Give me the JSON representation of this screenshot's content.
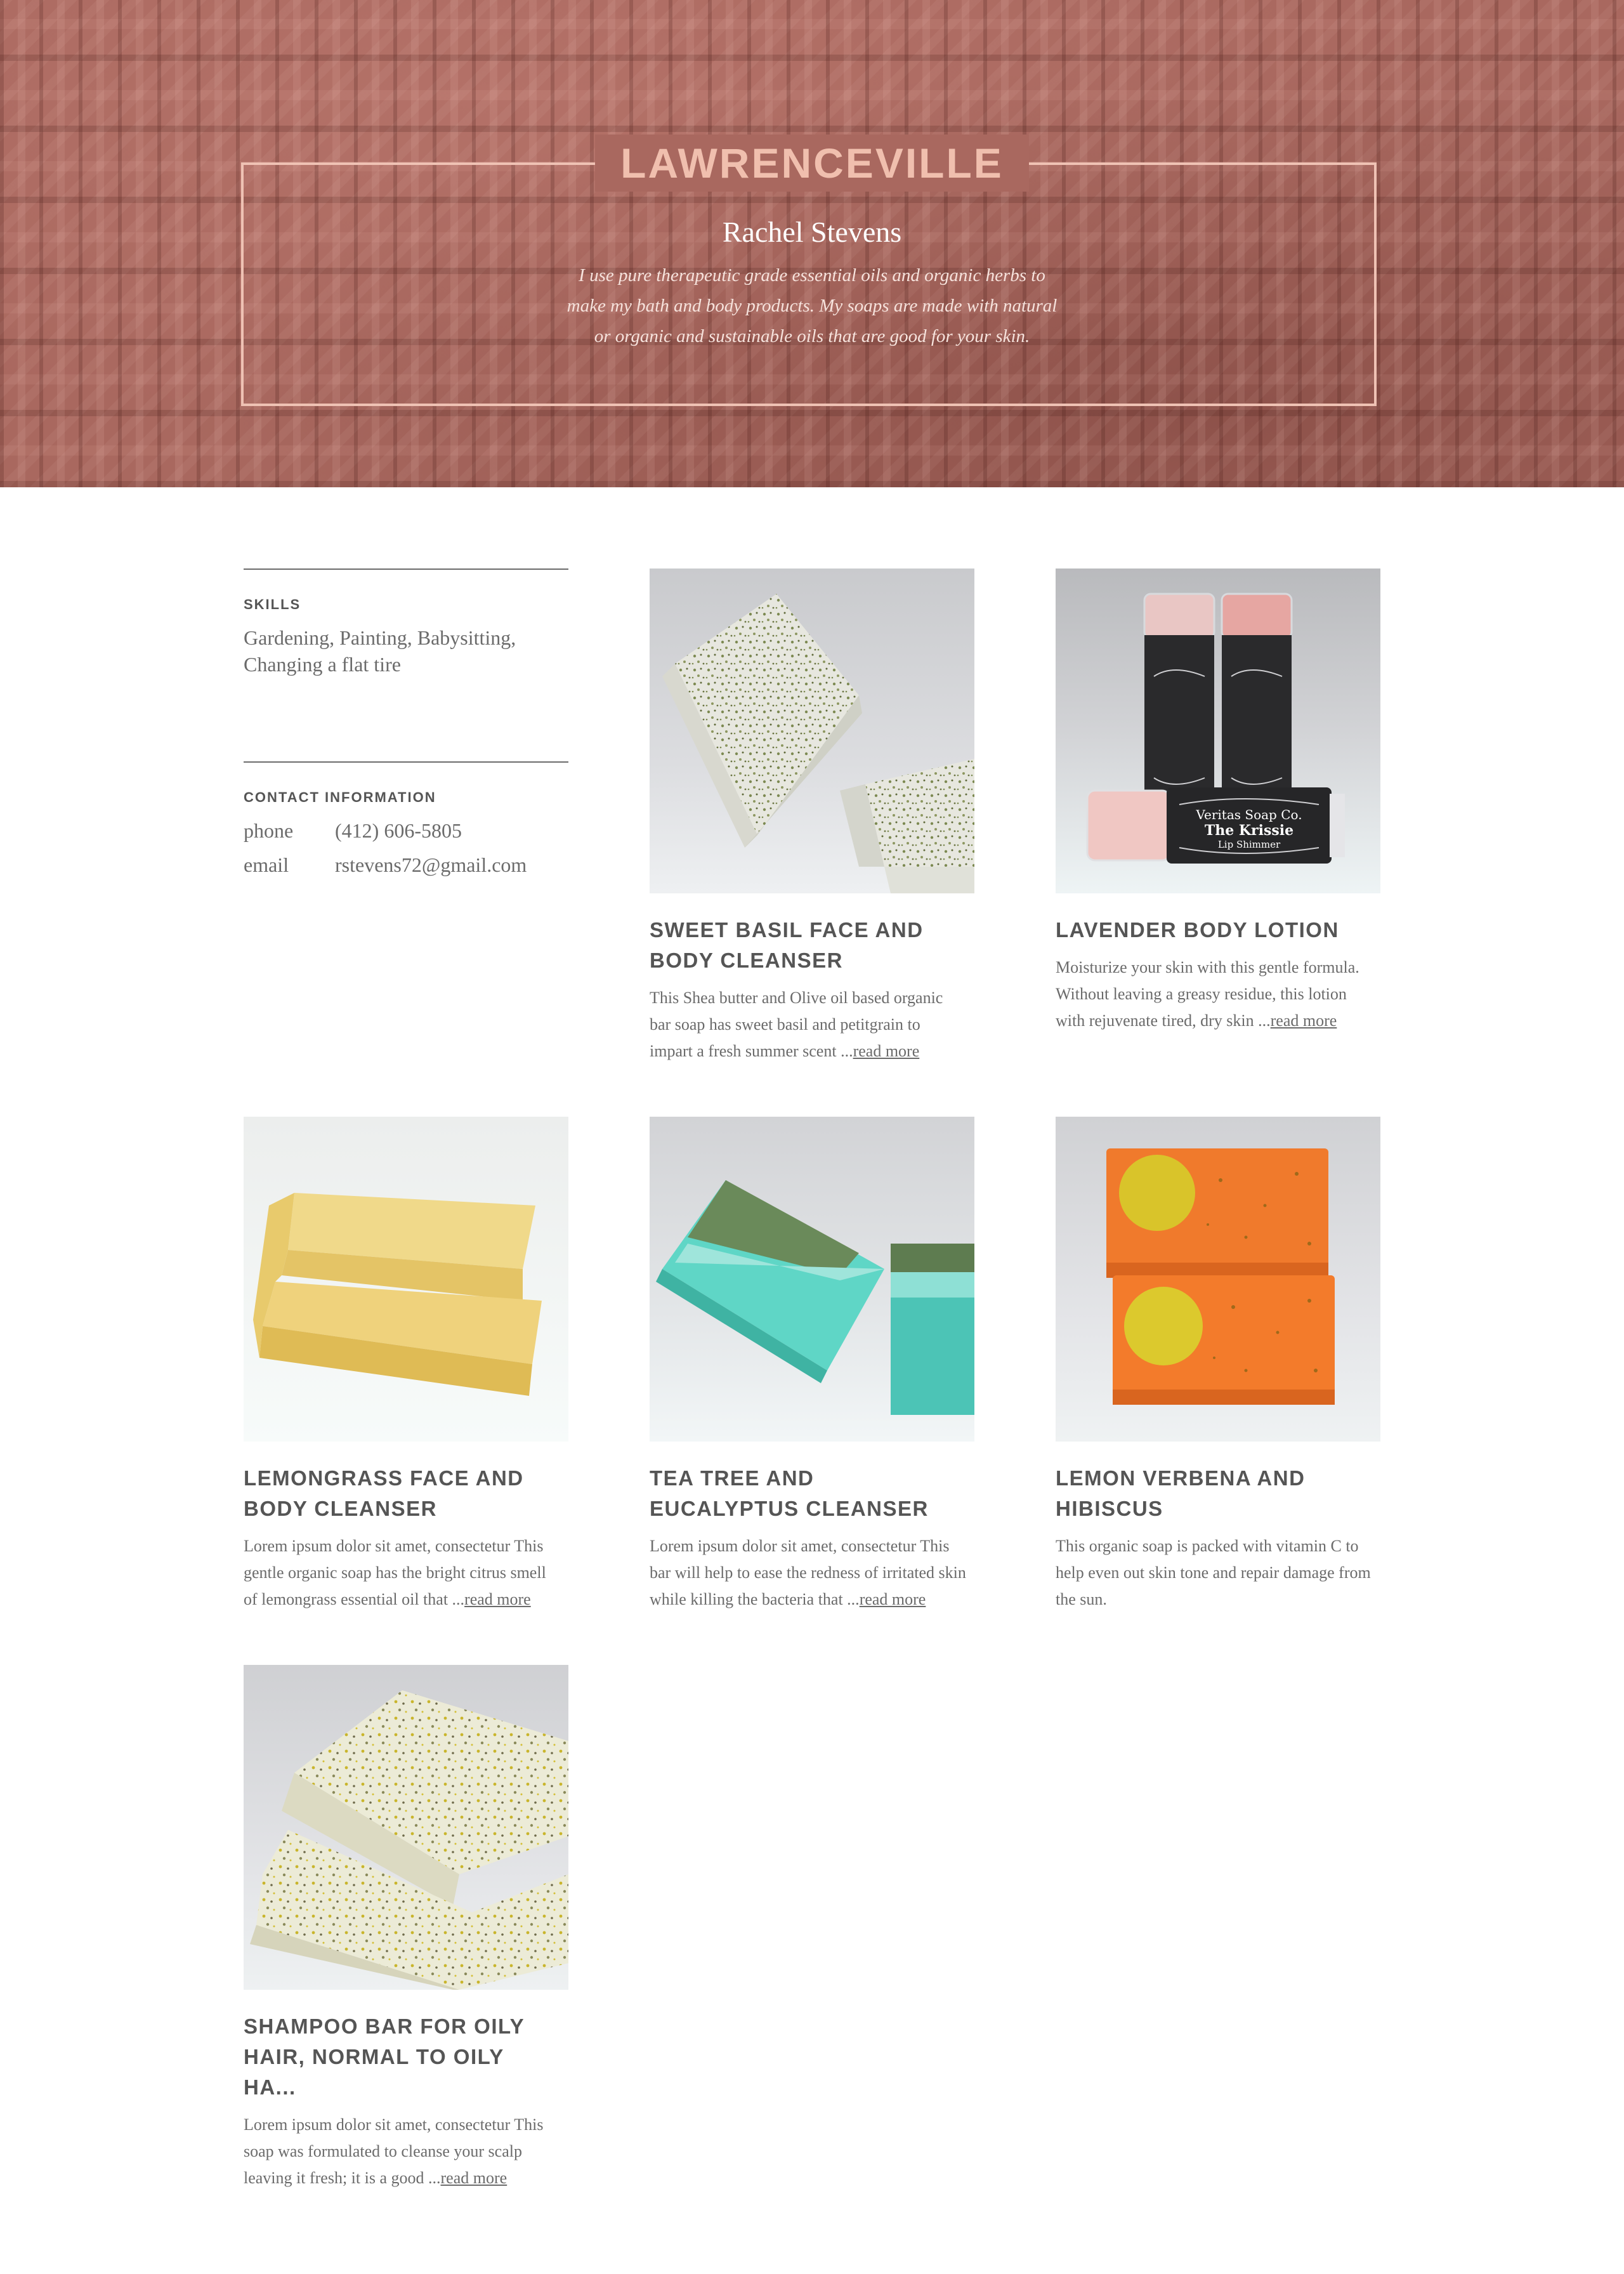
{
  "hero": {
    "title": "LAWRENCEVILLE",
    "name": "Rachel Stevens",
    "description": "I use pure therapeutic grade essential oils and organic herbs to make my bath and body products. My soaps are made with natural or organic and sustainable oils that are good for your skin."
  },
  "sidebar": {
    "skills": {
      "heading": "SKILLS",
      "text": "Gardening, Painting, Babysitting, Changing a flat tire"
    },
    "contact": {
      "heading": "CONTACT INFORMATION",
      "phone_label": "phone",
      "phone": "(412) 606-5805",
      "email_label": "email",
      "email": "rstevens72@gmail.com"
    }
  },
  "products": [
    {
      "title": "SWEET BASIL FACE AND BODY CLEANSER",
      "description": "This Shea butter and Olive oil based organic bar soap has sweet basil and petitgrain to impart a fresh summer scent ...",
      "more": "read more"
    },
    {
      "title": "LAVENDER BODY LOTION",
      "description": "Moisturize your skin with this gentle formula. Without leaving a greasy residue, this lotion with rejuvenate tired, dry skin ...",
      "more": "read more",
      "label_brand": "Veritas Soap Co.",
      "label_name": "The Krissie",
      "label_sub": "Lip Shimmer"
    },
    {
      "title": "LEMONGRASS FACE AND BODY CLEANSER",
      "description": "Lorem ipsum dolor sit amet, consectetur This gentle organic soap has the bright citrus smell of lemongrass essential oil that  ...",
      "more": "read more"
    },
    {
      "title": "TEA TREE AND EUCALYPTUS CLEANSER",
      "description": "Lorem ipsum dolor sit amet, consectetur This bar will help to ease the redness of irritated skin while killing the bacteria that ...",
      "more": "read more"
    },
    {
      "title": "LEMON VERBENA AND HIBISCUS",
      "description": "This organic soap is packed with vitamin C to help even out skin tone and repair damage from the sun.",
      "more": ""
    },
    {
      "title": "SHAMPOO BAR FOR OILY HAIR, NORMAL TO OILY HA...",
      "description": "Lorem ipsum dolor sit amet, consectetur This soap was formulated to cleanse your scalp leaving it fresh; it is a good ...",
      "more": "read more"
    }
  ],
  "colors": {
    "hero_bg": "#a9685f",
    "hero_accent": "#f0bfae",
    "heading_text": "#555555",
    "body_text": "#6b6b6b"
  }
}
